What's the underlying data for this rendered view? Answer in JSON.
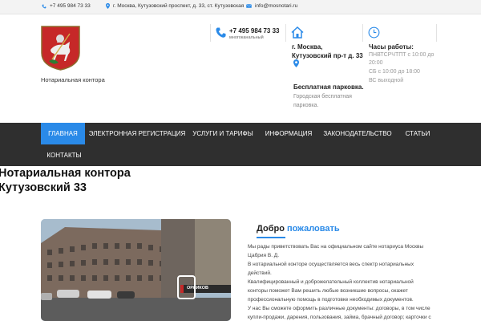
{
  "topbar": {
    "phone": "+7 495 984 73 33",
    "address": "г. Москва, Кутузовский проспект, д. 33, ст. Кутузовская",
    "email": "info@mosnotari.ru"
  },
  "header": {
    "org_name": "Нотариальная контора",
    "phone": "+7 495 984 73 33",
    "phone_sub": "многоканальный",
    "address_lines": [
      "г. Москва,",
      "Кутузовский пр-т д. 33"
    ],
    "parking_title": "Бесплатная парковка.",
    "parking_sub": "Городская бесплатная парковка.",
    "hours_title": "Часы работы:",
    "hours_lines": [
      "ПНВТСРЧТПТ с 10:00 до",
      "20:00",
      "СБ с 10:00 до 18:00",
      "ВС выходной"
    ]
  },
  "nav": {
    "items": [
      "ГЛАВНАЯ",
      "ЭЛЕКТРОННАЯ РЕГИСТРАЦИЯ",
      "УСЛУГИ И ТАРИФЫ",
      "ИНФОРМАЦИЯ",
      "ЗАКОНОДАТЕЛЬСТВО",
      "СТАТЬИ",
      "КОНТАКТЫ"
    ],
    "active_index": 0
  },
  "page_title": [
    "Нотариальная контора",
    "Кутузовский 33"
  ],
  "photo": {
    "street_sign": "ОРЛИКОВ"
  },
  "welcome": {
    "title": "Добро",
    "title_highlight": "пожаловать",
    "lines": [
      "Мы рады приветствовать Вас на официальном сайте нотариуса Москвы",
      "Цабрия В. Д.",
      "В нотариальной конторе осуществляется весь спектр нотариальных",
      "действий.",
      "Квалифицированный и доброжелательный коллектив нотариальной",
      "конторы поможет Вам решить любые возникшие вопросы, окажет",
      "профессиональную помощь в подготовке необходимых документов.",
      "У нас Вы сможете оформить различные документы: договоры, в том числе",
      "купли-продажи, дарения, пользования, займа, брачный договор; карточки с"
    ]
  },
  "colors": {
    "accent": "#2a8ae8",
    "nav_bg": "#2f2f2f",
    "topbar_bg": "#f3f3f3"
  }
}
